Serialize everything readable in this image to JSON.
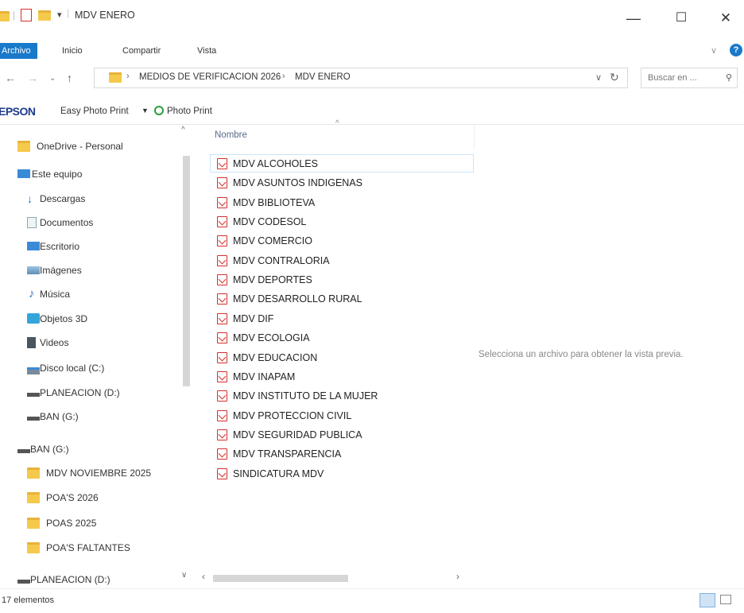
{
  "window": {
    "title": "MDV ENERO",
    "minimize_glyph": "—",
    "maximize_glyph": "☐",
    "close_glyph": "✕"
  },
  "ribbon": {
    "tabs": [
      {
        "label": "Archivo",
        "active": true
      },
      {
        "label": "Inicio",
        "active": false
      },
      {
        "label": "Compartir",
        "active": false
      },
      {
        "label": "Vista",
        "active": false
      }
    ]
  },
  "address": {
    "breadcrumb": [
      "MEDIOS DE VERIFICACION 2026",
      "MDV ENERO"
    ],
    "search_placeholder": "Buscar en ..."
  },
  "epson_bar": {
    "brand": "EPSON",
    "easy_photo_print": "Easy Photo Print",
    "photo_print": "Photo Print"
  },
  "nav_pane": {
    "items": [
      {
        "label": "OneDrive - Personal",
        "icon": "folder-icon"
      },
      {
        "label": "Este equipo",
        "icon": "computer-icon"
      },
      {
        "label": "Descargas",
        "icon": "download-icon"
      },
      {
        "label": "Documentos",
        "icon": "document-icon"
      },
      {
        "label": "Escritorio",
        "icon": "desktop-icon"
      },
      {
        "label": "Imágenes",
        "icon": "pictures-icon"
      },
      {
        "label": "Música",
        "icon": "music-icon"
      },
      {
        "label": "Objetos 3D",
        "icon": "3d-objects-icon"
      },
      {
        "label": "Videos",
        "icon": "video-icon"
      },
      {
        "label": "Disco local (C:)",
        "icon": "drive-c-icon"
      },
      {
        "label": "PLANEACION (D:)",
        "icon": "drive-icon"
      },
      {
        "label": "BAN (G:)",
        "icon": "drive-icon"
      },
      {
        "label": "BAN (G:)",
        "icon": "drive-icon"
      },
      {
        "label": "MDV NOVIEMBRE 2025",
        "icon": "folder-icon"
      },
      {
        "label": "POA'S 2026",
        "icon": "folder-icon"
      },
      {
        "label": "POAS 2025",
        "icon": "folder-icon"
      },
      {
        "label": "POA'S FALTANTES",
        "icon": "folder-icon"
      },
      {
        "label": "PLANEACION (D:)",
        "icon": "drive-icon"
      }
    ]
  },
  "file_list": {
    "column_header": "Nombre",
    "files": [
      "MDV ALCOHOLES",
      "MDV ASUNTOS INDIGENAS",
      "MDV BIBLIOTEVA",
      "MDV CODESOL",
      "MDV COMERCIO",
      "MDV CONTRALORIA",
      "MDV DEPORTES",
      "MDV DESARROLLO RURAL",
      "MDV DIF",
      "MDV ECOLOGIA",
      "MDV EDUCACION",
      "MDV INAPAM",
      "MDV INSTITUTO DE LA MUJER",
      "MDV PROTECCION CIVIL",
      "MDV SEGURIDAD PUBLICA",
      "MDV TRANSPARENCIA",
      "SINDICATURA MDV"
    ]
  },
  "preview_pane": {
    "message": "Selecciona un archivo para obtener la vista previa."
  },
  "status": {
    "item_count": "17 elementos"
  },
  "colors": {
    "accent": "#1979ca",
    "folder": "#f5c94b",
    "pdf": "#d4302c",
    "selection_border": "#cce4f7"
  }
}
